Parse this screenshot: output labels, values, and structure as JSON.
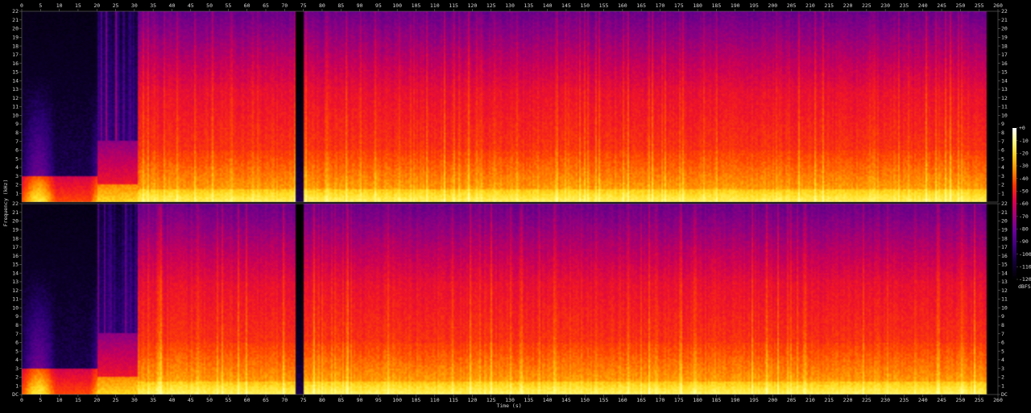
{
  "chart_data": {
    "type": "heatmap",
    "subtype": "spectrogram",
    "channels": 2,
    "xlabel": "Time (s)",
    "ylabel": "Frequency (kHz)",
    "xlim": [
      0,
      260
    ],
    "ylim": [
      0,
      22
    ],
    "x_ticks": [
      "0",
      "5",
      "10",
      "15",
      "20",
      "25",
      "30",
      "35",
      "40",
      "45",
      "50",
      "55",
      "60",
      "65",
      "70",
      "75",
      "80",
      "85",
      "90",
      "95",
      "100",
      "105",
      "110",
      "115",
      "120",
      "125",
      "130",
      "135",
      "140",
      "145",
      "150",
      "155",
      "160",
      "165",
      "170",
      "175",
      "180",
      "185",
      "190",
      "195",
      "200",
      "205",
      "210",
      "215",
      "220",
      "225",
      "230",
      "235",
      "240",
      "245",
      "250",
      "255",
      "260"
    ],
    "y_ticks": [
      "22",
      "21",
      "20",
      "19",
      "18",
      "17",
      "16",
      "15",
      "14",
      "13",
      "12",
      "11",
      "10",
      "9",
      "8",
      "7",
      "6",
      "5",
      "4",
      "3",
      "2",
      "1"
    ],
    "dc_label": "DC",
    "colorbar": {
      "unit": "dBFS",
      "ticks": [
        "+0",
        "-10",
        "-20",
        "-30",
        "-40",
        "-50",
        "-60",
        "-70",
        "-80",
        "-90",
        "-100",
        "-110",
        "-120"
      ],
      "range": [
        -120,
        0
      ]
    },
    "segments_s": [
      {
        "start": 0,
        "end": 20,
        "level": "quiet intro"
      },
      {
        "start": 20,
        "end": 31,
        "level": "sparse transients"
      },
      {
        "start": 31,
        "end": 73,
        "level": "loud"
      },
      {
        "start": 73,
        "end": 75,
        "level": "near silence"
      },
      {
        "start": 75,
        "end": 147,
        "level": "loud"
      },
      {
        "start": 147,
        "end": 168,
        "level": "loud"
      },
      {
        "start": 168,
        "end": 257,
        "level": "loud"
      },
      {
        "start": 257,
        "end": 260,
        "level": "silence"
      }
    ]
  },
  "colors": {
    "background": "#000000",
    "text": "#d8d8d8",
    "axis": "#6a6a6a"
  }
}
